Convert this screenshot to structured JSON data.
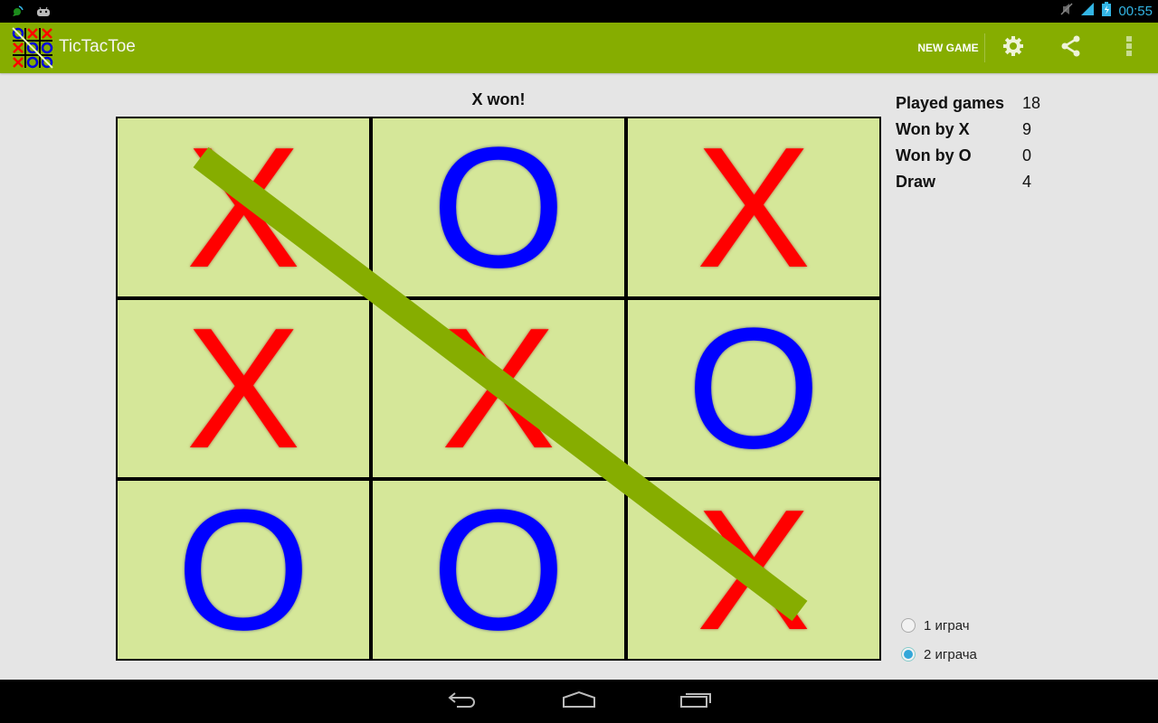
{
  "status_bar": {
    "time": "00:55",
    "icons": [
      "satellite-dish-icon",
      "android-icon",
      "muted-icon",
      "signal-icon",
      "battery-charging-icon"
    ]
  },
  "action_bar": {
    "title": "TicTacToe",
    "new_game_label": "NEW GAME",
    "icons": [
      "settings-icon",
      "share-icon",
      "overflow-menu-icon"
    ],
    "color": "#86ad00"
  },
  "game": {
    "status": "X won!",
    "board": [
      [
        "X",
        "O",
        "X"
      ],
      [
        "X",
        "X",
        "O"
      ],
      [
        "O",
        "O",
        "X"
      ]
    ],
    "winning_line": "diagonal-top-left-to-bottom-right",
    "x_color": "#ff0000",
    "o_color": "#0000ff",
    "cell_color": "#d5e799"
  },
  "stats": [
    {
      "label": "Played games",
      "value": "18"
    },
    {
      "label": "Won by X",
      "value": "9"
    },
    {
      "label": "Won by O",
      "value": "0"
    },
    {
      "label": "Draw",
      "value": "4"
    }
  ],
  "player_mode": {
    "options": [
      {
        "label": "1 играч",
        "checked": false
      },
      {
        "label": "2 играча",
        "checked": true
      }
    ]
  },
  "nav_bar": {
    "icons": [
      "back-icon",
      "home-icon",
      "recent-apps-icon"
    ]
  }
}
